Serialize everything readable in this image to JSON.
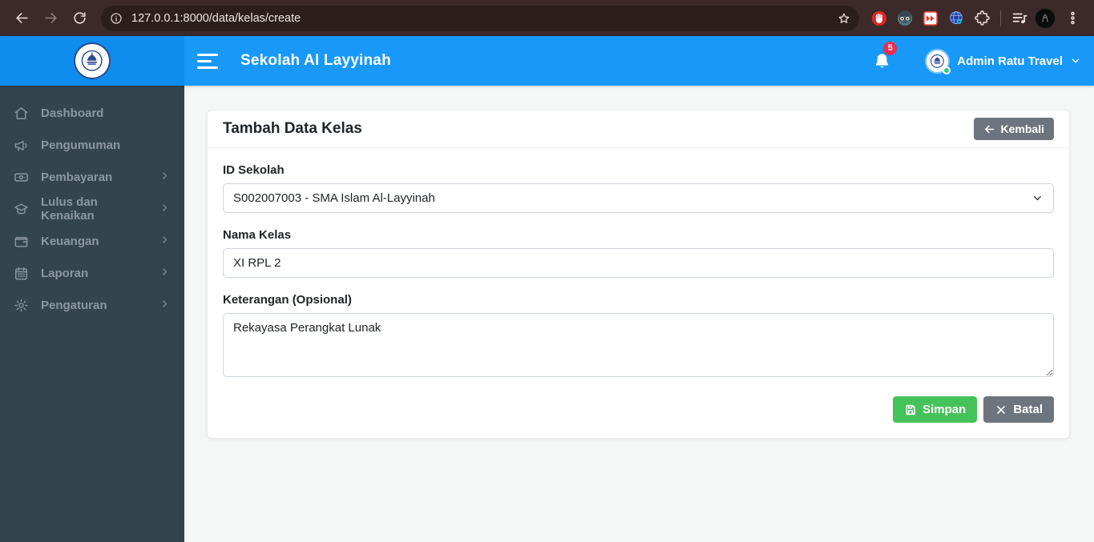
{
  "browser": {
    "url": "127.0.0.1:8000/data/kelas/create"
  },
  "header": {
    "title": "Sekolah Al Layyinah",
    "notification_count": "5",
    "user_name": "Admin Ratu Travel"
  },
  "sidebar": {
    "items": [
      {
        "label": "Dashboard",
        "icon": "home-icon",
        "has_submenu": false
      },
      {
        "label": "Pengumuman",
        "icon": "megaphone-icon",
        "has_submenu": false
      },
      {
        "label": "Pembayaran",
        "icon": "banknote-icon",
        "has_submenu": true
      },
      {
        "label": "Lulus dan Kenaikan",
        "icon": "graduation-cap-icon",
        "has_submenu": true
      },
      {
        "label": "Keuangan",
        "icon": "wallet-icon",
        "has_submenu": true
      },
      {
        "label": "Laporan",
        "icon": "calendar-icon",
        "has_submenu": true
      },
      {
        "label": "Pengaturan",
        "icon": "gear-icon",
        "has_submenu": true
      }
    ]
  },
  "page": {
    "card_title": "Tambah Data Kelas",
    "back_button_label": "Kembali",
    "save_button_label": "Simpan",
    "cancel_button_label": "Batal"
  },
  "form": {
    "id_sekolah": {
      "label": "ID Sekolah",
      "value": "S002007003 - SMA Islam Al-Layyinah"
    },
    "nama_kelas": {
      "label": "Nama Kelas",
      "value": "XI RPL 2"
    },
    "keterangan": {
      "label": "Keterangan (Opsional)",
      "value": "Rekayasa Perangkat Lunak"
    }
  },
  "colors": {
    "header_blue": "#1899fa",
    "brand_blue_dark": "#0f8dee",
    "sidebar_dark": "#33444f",
    "sidebar_text": "#8b97a2",
    "success_green": "#46c25a",
    "secondary_gray": "#6c757d",
    "badge_red": "#ed2c4e",
    "chrome_brown": "#3b2a29",
    "content_bg": "#f5f6f6"
  }
}
